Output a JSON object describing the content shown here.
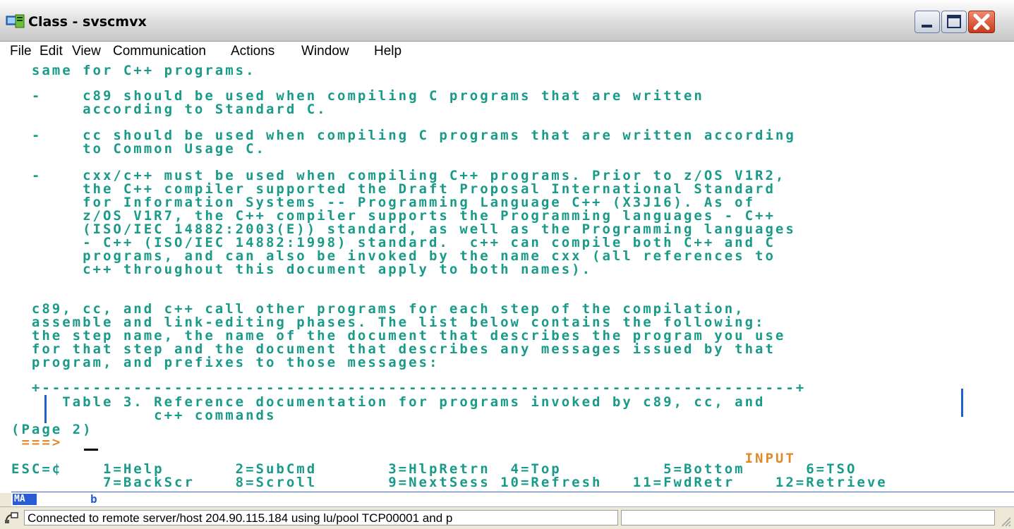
{
  "window": {
    "title": "Class - svscmvx"
  },
  "menu": [
    "File",
    "Edit",
    "View",
    "Communication",
    "Actions",
    "Window",
    "Help"
  ],
  "terminal": {
    "lines": [
      {
        "text": "  same for C++ programs.",
        "color": "green"
      },
      {
        "text": "  -    c89 should be used when compiling C programs that are written",
        "color": "green"
      },
      {
        "text": "       according to Standard C.",
        "color": "green"
      },
      {
        "text": "  -    cc should be used when compiling C programs that are written according",
        "color": "green"
      },
      {
        "text": "       to Common Usage C.",
        "color": "green"
      },
      {
        "text": "  -    cxx/c++ must be used when compiling C++ programs. Prior to z/OS V1R2,",
        "color": "green"
      },
      {
        "text": "       the C++ compiler supported the Draft Proposal International Standard",
        "color": "green"
      },
      {
        "text": "       for Information Systems -- Programming Language C++ (X3J16). As of",
        "color": "green"
      },
      {
        "text": "       z/OS V1R7, the C++ compiler supports the Programming languages - C++",
        "color": "green"
      },
      {
        "text": "       (ISO/IEC 14882:2003(E)) standard, as well as the Programming languages",
        "color": "green"
      },
      {
        "text": "       - C++ (ISO/IEC 14882:1998) standard.  c++ can compile both C++ and C",
        "color": "green"
      },
      {
        "text": "       programs, and can also be invoked by the name cxx (all references to",
        "color": "green"
      },
      {
        "text": "       c++ throughout this document apply to both names).",
        "color": "green"
      },
      {
        "text": "  c89, cc, and c++ call other programs for each step of the compilation,",
        "color": "green"
      },
      {
        "text": "  assemble and link-editing phases. The list below contains the following:",
        "color": "green"
      },
      {
        "text": "  the step name, the name of the document that describes the program you use",
        "color": "green"
      },
      {
        "text": "  for that step and the document that describes any messages issued by that",
        "color": "green"
      },
      {
        "text": "  program, and prefixes to those messages:",
        "color": "green"
      },
      {
        "text": "  +--------------------------------------------------------------------------+",
        "color": "green"
      },
      {
        "text": "     Table 3. Reference documentation for programs invoked by c89, cc, and",
        "color": "green"
      },
      {
        "text": "              c++ commands",
        "color": "green"
      },
      {
        "text": "(Page 2)",
        "color": "green"
      },
      {
        "text": " ===>",
        "color": "orange"
      },
      {
        "text": "                                                                        INPUT",
        "color": "orange"
      },
      {
        "text": "ESC=¢    1=Help       2=SubCmd       3=HlpRetrn  4=Top          5=Bottom      6=TSO",
        "color": "green"
      },
      {
        "text": "         7=BackScr    8=Scroll       9=NextSess 10=Refresh   11=FwdRetr    12=Retrieve",
        "color": "green"
      }
    ]
  },
  "oia": {
    "mode": "MA",
    "indicator": "b"
  },
  "status": {
    "message": "Connected to remote server/host 204.90.115.184 using lu/pool TCP00001 and p"
  },
  "colors": {
    "green": "#1a9a88",
    "orange": "#e08a2a",
    "oia_blue": "#2a5bd7"
  }
}
